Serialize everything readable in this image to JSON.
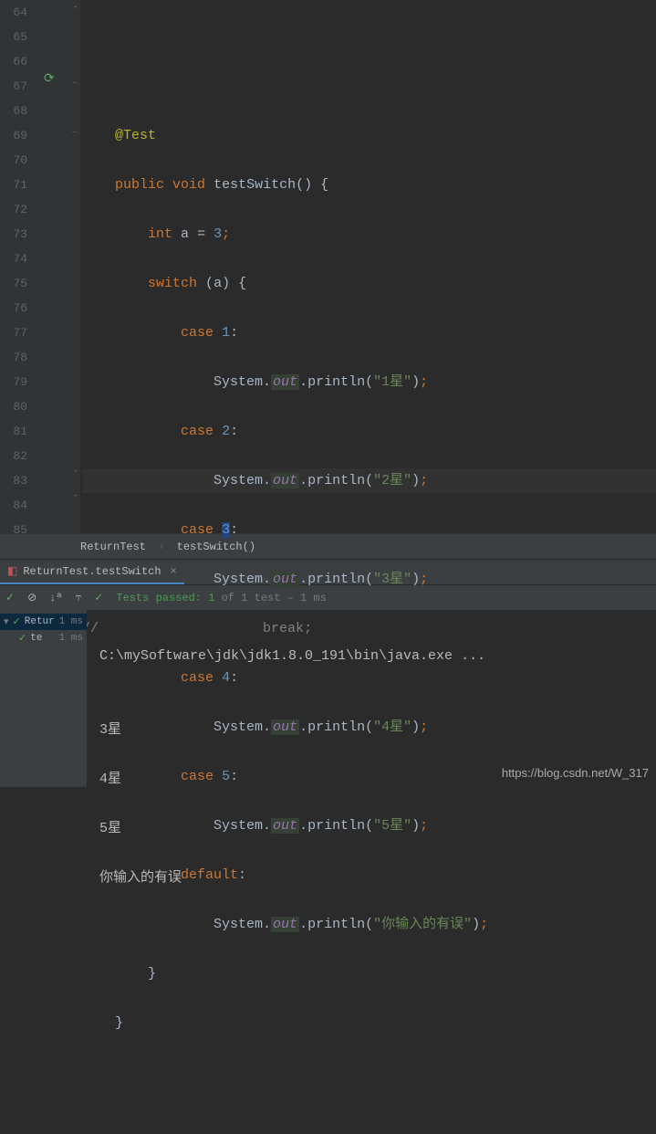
{
  "lines": {
    "start": 64,
    "end": 85
  },
  "code": {
    "annotation": "@Test",
    "modifiers": "public void",
    "method": "testSwitch",
    "int_kw": "int",
    "var_a": "a",
    "assign_val": "3",
    "switch_kw": "switch",
    "case_kw": "case",
    "default_kw": "default",
    "break_kw": "break",
    "sys": "System.",
    "out": "out",
    "println": ".println",
    "case1_val": "1",
    "case1_str": "\"1星\"",
    "case2_val": "2",
    "case2_str": "\"2星\"",
    "case3_val": "3",
    "case3_str": "\"3星\"",
    "case4_val": "4",
    "case4_str": "\"4星\"",
    "case5_val": "5",
    "case5_str": "\"5星\"",
    "default_str": "\"你输入的有误\"",
    "comment_prefix": "//"
  },
  "breadcrumb": {
    "class": "ReturnTest",
    "method": "testSwitch()"
  },
  "tab": {
    "label": "ReturnTest.testSwitch"
  },
  "test_status": {
    "prefix": "Tests passed: ",
    "count": "1",
    "suffix": " of 1 test – 1 ms"
  },
  "tree": {
    "node1": "Retur",
    "node1_time": "1 ms",
    "node2": "te",
    "node2_time": "1 ms"
  },
  "console": {
    "line1": "C:\\mySoftware\\jdk\\jdk1.8.0_191\\bin\\java.exe ...",
    "line2": "",
    "line3": "3星",
    "line4": "4星",
    "line5": "5星",
    "line6": "你输入的有误"
  },
  "watermark": "https://blog.csdn.net/W_317"
}
